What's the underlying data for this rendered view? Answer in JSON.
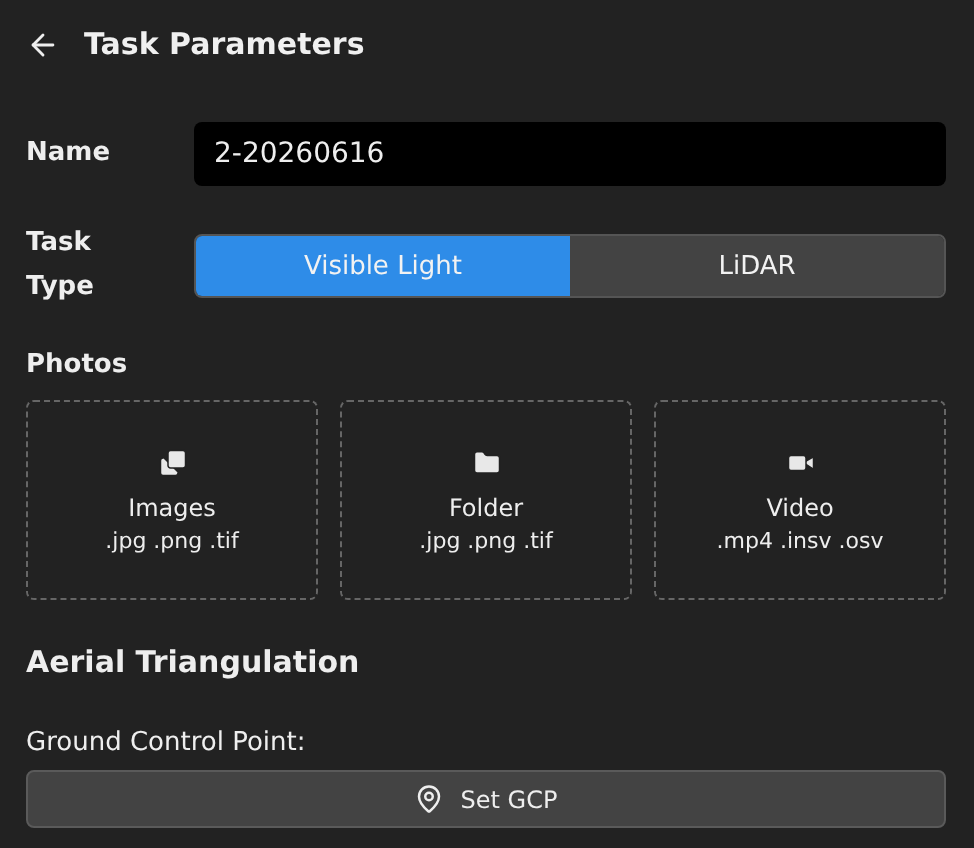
{
  "header": {
    "title": "Task Parameters"
  },
  "name_field": {
    "label": "Name",
    "value": "2-20260616"
  },
  "task_type": {
    "label": "Task Type",
    "options": [
      {
        "label": "Visible Light",
        "selected": true
      },
      {
        "label": "LiDAR",
        "selected": false
      }
    ]
  },
  "photos": {
    "label": "Photos",
    "sources": [
      {
        "kind": "images",
        "title": "Images",
        "formats": ".jpg .png .tif"
      },
      {
        "kind": "folder",
        "title": "Folder",
        "formats": ".jpg .png .tif"
      },
      {
        "kind": "video",
        "title": "Video",
        "formats": ".mp4 .insv .osv"
      }
    ]
  },
  "aerial_triangulation": {
    "title": "Aerial Triangulation",
    "gcp_label": "Ground Control Point:",
    "gcp_button": "Set GCP"
  }
}
